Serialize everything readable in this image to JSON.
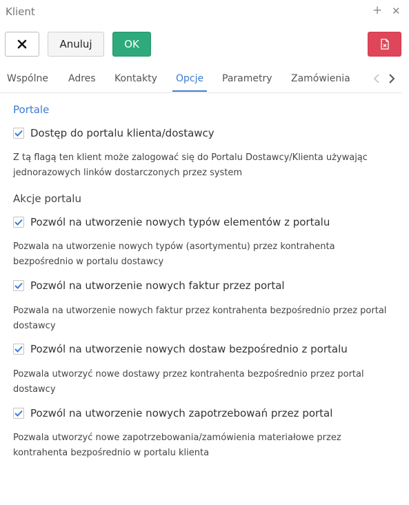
{
  "window": {
    "title": "Klient"
  },
  "toolbar": {
    "cancel_label": "Anuluj",
    "ok_label": "OK"
  },
  "tabs": [
    {
      "label": "Wspólne"
    },
    {
      "label": "Adres"
    },
    {
      "label": "Kontakty"
    },
    {
      "label": "Opcje"
    },
    {
      "label": "Parametry"
    },
    {
      "label": "Zamówienia"
    }
  ],
  "active_tab": "Opcje",
  "colors": {
    "accent": "#3a7bd5",
    "ok": "#2eaa7c",
    "danger": "#e04659"
  },
  "content": {
    "portal_heading": "Portale",
    "portal_access": {
      "label": "Dostęp do portalu klienta/dostawcy",
      "checked": true,
      "description": "Z tą flagą ten klient może zalogować się do Portalu Dostawcy/Klienta używając jednorazowych linków dostarczonych przez system"
    },
    "actions_heading": "Akcje portalu",
    "actions": [
      {
        "label": "Pozwól na utworzenie nowych typów elementów z portalu",
        "checked": true,
        "description": "Pozwala na utworzenie nowych typów (asortymentu) przez kontrahenta bezpośrednio w portalu dostawcy"
      },
      {
        "label": "Pozwól na utworzenie nowych faktur przez portal",
        "checked": true,
        "description": "Pozwala na utworzenie nowych faktur przez kontrahenta bezpośrednio przez portal dostawcy"
      },
      {
        "label": "Pozwól na utworzenie nowych dostaw bezpośrednio z portalu",
        "checked": true,
        "description": "Pozwala utworzyć nowe dostawy przez kontrahenta bezpośrednio przez portal dostawcy"
      },
      {
        "label": "Pozwól na utworzenie nowych zapotrzebowań przez portal",
        "checked": true,
        "description": "Pozwala utworzyć nowe zapotrzebowania/zamówienia materiałowe przez kontrahenta bezpośrednio w portalu klienta"
      }
    ]
  }
}
